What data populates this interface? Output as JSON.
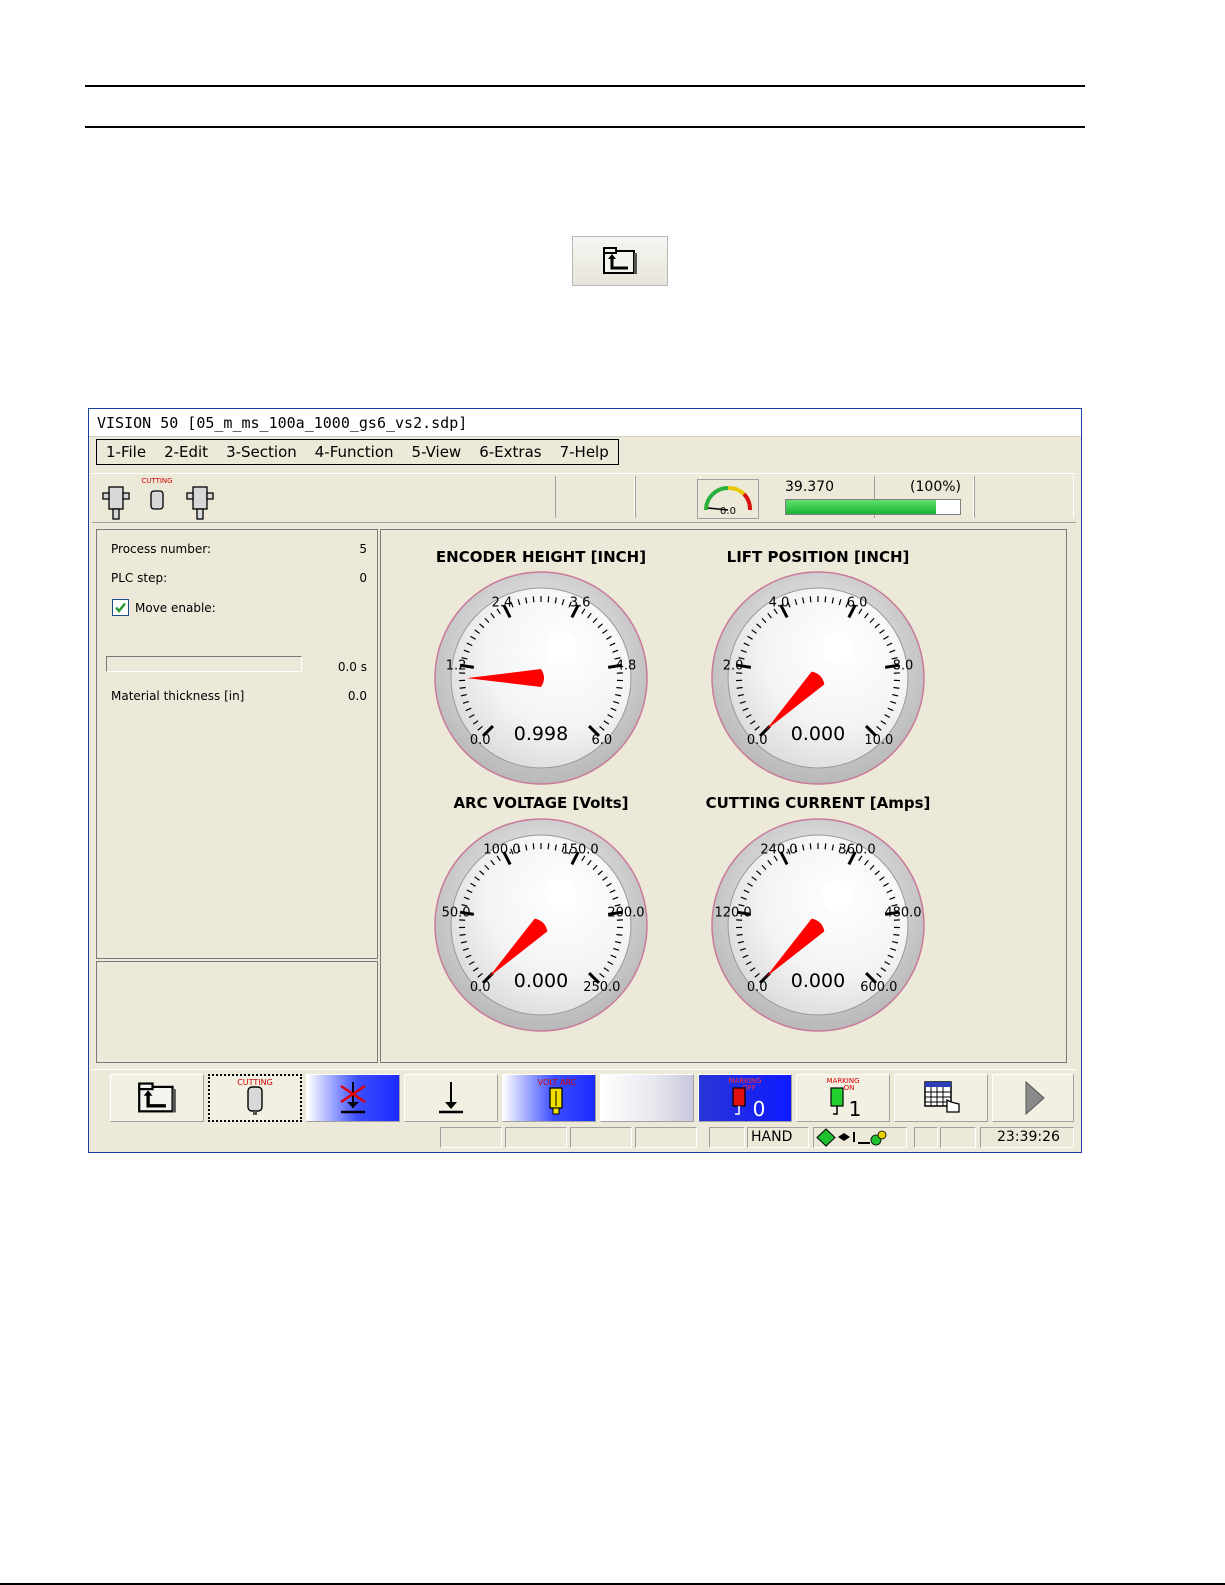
{
  "window": {
    "title": "VISION 50 [05_m_ms_100a_1000_gs6_vs2.sdp]"
  },
  "menu": [
    {
      "label": "1-File"
    },
    {
      "label": "2-Edit"
    },
    {
      "label": "3-Section"
    },
    {
      "label": "4-Function"
    },
    {
      "label": "5-View"
    },
    {
      "label": "6-Extras"
    },
    {
      "label": "7-Help"
    }
  ],
  "toolbar": {
    "cutting_label": "CUTTING",
    "mini_gauge_value": "0.0",
    "progress_value": "39.370",
    "progress_percent_label": "(100%)",
    "progress_fraction": 0.86
  },
  "process": {
    "process_number_label": "Process number:",
    "process_number_value": "5",
    "plc_step_label": "PLC step:",
    "plc_step_value": "0",
    "move_enable_label": "Move enable:",
    "move_enable_checked": true,
    "timer_value": "0.0 s",
    "material_thickness_label": "Material thickness [in]",
    "material_thickness_value": "0.0"
  },
  "gauges": [
    {
      "title": "ENCODER HEIGHT [INCH]",
      "min": 0,
      "max": 6,
      "value": 0.998,
      "readout": "0.998",
      "ticks": [
        "0.0",
        "1.2",
        "2.4",
        "3.6",
        "4.8",
        "6.0"
      ]
    },
    {
      "title": "LIFT POSITION [INCH]",
      "min": 0,
      "max": 10,
      "value": 0,
      "readout": "0.000",
      "ticks": [
        "0.0",
        "2.0",
        "4.0",
        "6.0",
        "8.0",
        "10.0"
      ]
    },
    {
      "title": "ARC VOLTAGE [Volts]",
      "min": 0,
      "max": 250,
      "value": 0,
      "readout": "0.000",
      "ticks": [
        "0.0",
        "50.0",
        "100.0",
        "150.0",
        "200.0",
        "250.0"
      ]
    },
    {
      "title": "CUTTING CURRENT [Amps]",
      "min": 0,
      "max": 600,
      "value": 0,
      "readout": "0.000",
      "ticks": [
        "0.0",
        "120.0",
        "240.0",
        "360.0",
        "480.0",
        "600.0"
      ]
    }
  ],
  "buttons": {
    "cutting_label": "CUTTING",
    "volt_arc_label": "VOLT ARC",
    "marking_off_label": "MARKING",
    "marking_off_sub": "OFF",
    "marking_off_digit": "0",
    "marking_on_label": "MARKING",
    "marking_on_sub": "ON",
    "marking_on_digit": "1"
  },
  "status": {
    "mode": "HAND",
    "clock": "23:39:26"
  },
  "colors": {
    "needle": "#ff0000",
    "progress": "#22c43a",
    "stop": "#c8101a"
  }
}
